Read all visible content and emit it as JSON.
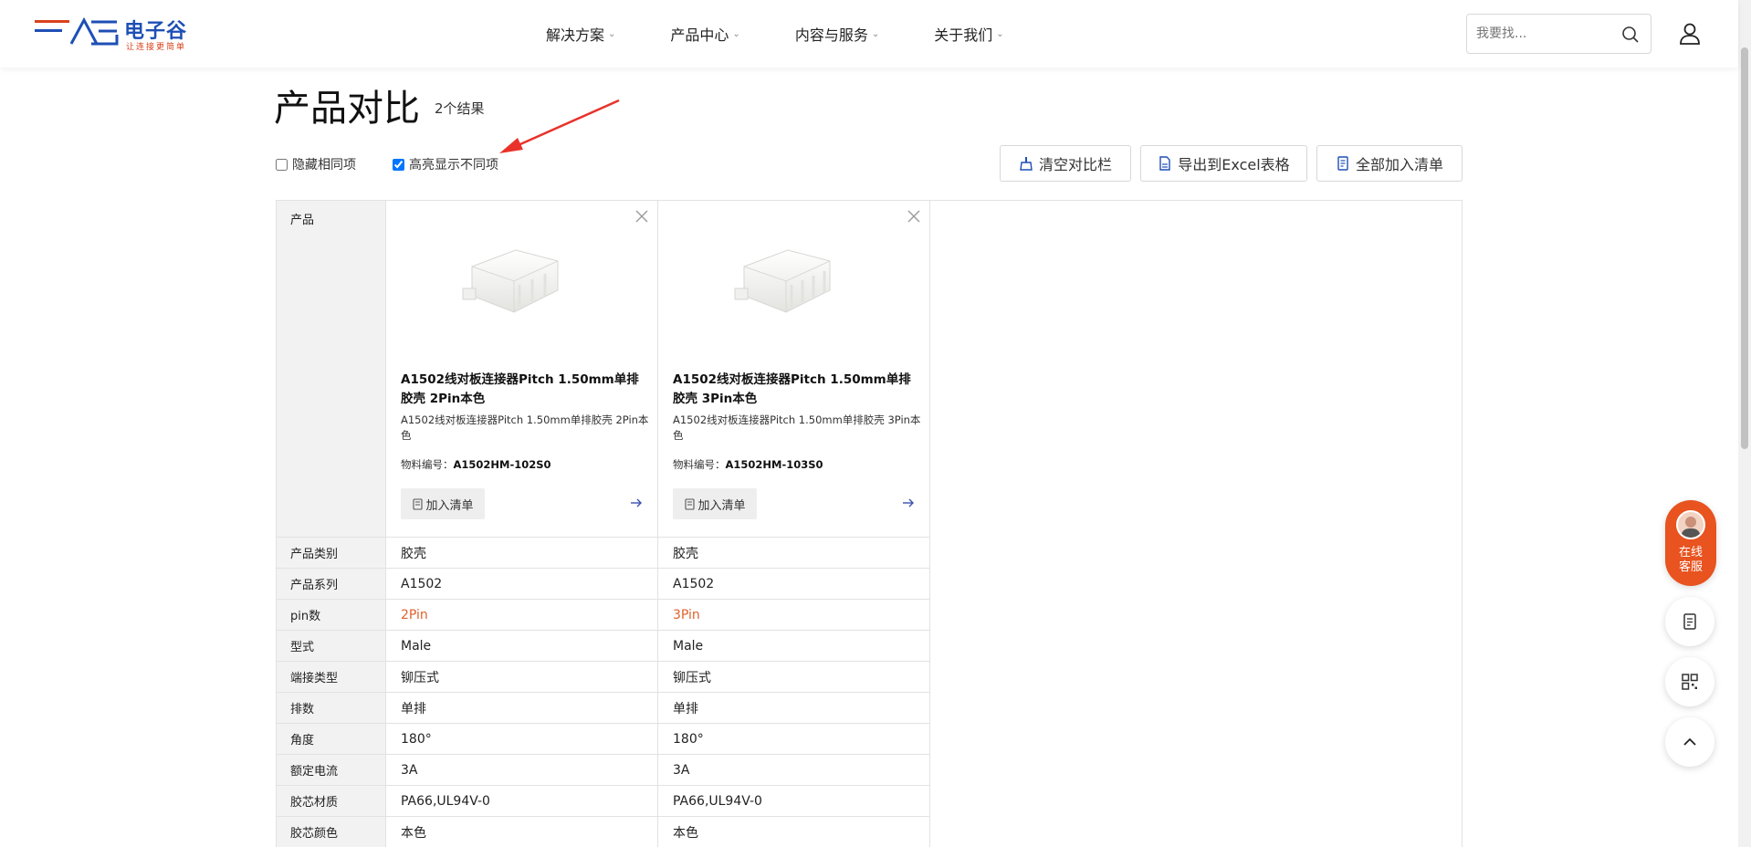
{
  "header": {
    "logo_text": "电子谷",
    "logo_sub": "让连接更简单",
    "nav": [
      {
        "label": "解决方案"
      },
      {
        "label": "产品中心"
      },
      {
        "label": "内容与服务"
      },
      {
        "label": "关于我们"
      }
    ],
    "search_placeholder": "我要找..."
  },
  "page": {
    "title": "产品对比",
    "result_count": "2个结果",
    "options": {
      "hide_same": {
        "label": "隐藏相同项",
        "checked": false
      },
      "highlight_diff": {
        "label": "高亮显示不同项",
        "checked": true
      }
    },
    "buttons": {
      "clear": "清空对比栏",
      "export": "导出到Excel表格",
      "add_all": "全部加入清单"
    }
  },
  "table": {
    "product_label": "产品",
    "attributes": [
      "产品类别",
      "产品系列",
      "pin数",
      "型式",
      "端接类型",
      "排数",
      "角度",
      "额定电流",
      "胶芯材质",
      "胶芯颜色"
    ],
    "products": [
      {
        "title": "A1502线对板连接器Pitch 1.50mm单排胶壳 2Pin本色",
        "desc": "A1502线对板连接器Pitch 1.50mm单排胶壳 2Pin本色",
        "pn_label": "物料编号：",
        "pn": "A1502HM-102S0",
        "add_label": "加入清单",
        "values": [
          "胶壳",
          "A1502",
          "2Pin",
          "Male",
          "铆压式",
          "单排",
          "180°",
          "3A",
          "PA66,UL94V-0",
          "本色"
        ]
      },
      {
        "title": "A1502线对板连接器Pitch 1.50mm单排胶壳 3Pin本色",
        "desc": "A1502线对板连接器Pitch 1.50mm单排胶壳 3Pin本色",
        "pn_label": "物料编号：",
        "pn": "A1502HM-103S0",
        "add_label": "加入清单",
        "values": [
          "胶壳",
          "A1502",
          "3Pin",
          "Male",
          "铆压式",
          "单排",
          "180°",
          "3A",
          "PA66,UL94V-0",
          "本色"
        ]
      }
    ],
    "diff_rows": [
      2
    ]
  },
  "floating": {
    "service_line1": "在线",
    "service_line2": "客服"
  },
  "colors": {
    "accent": "#e8531f",
    "diff": "#e0622a",
    "brand_blue": "#1e4fb5",
    "arrow_red": "#e8322a"
  }
}
